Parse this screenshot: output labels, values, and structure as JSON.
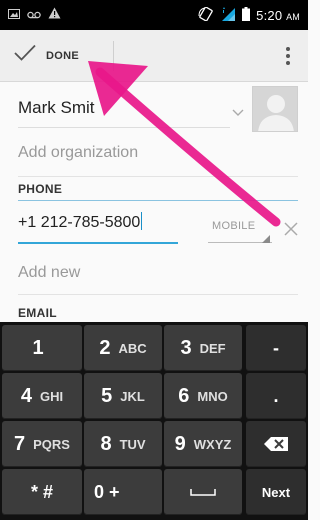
{
  "status_bar": {
    "time": "5:20",
    "ampm": "AM",
    "left_icons": [
      "image-notification-icon",
      "voicemail-icon",
      "warning-icon"
    ],
    "right_icons": [
      "rotation-icon",
      "signal-icon",
      "battery-icon"
    ]
  },
  "action_bar": {
    "done_label": "DONE",
    "overflow_icon": "overflow-menu-icon"
  },
  "form": {
    "name_value": "Mark Smit",
    "add_organization": "Add organization",
    "phone_section": "PHONE",
    "phone_value": "+1 212-785-5800",
    "phone_type": "MOBILE",
    "add_new": "Add new",
    "email_section": "EMAIL"
  },
  "keyboard": {
    "rows": [
      [
        {
          "main": "1",
          "sub": ""
        },
        {
          "main": "2",
          "sub": "ABC"
        },
        {
          "main": "3",
          "sub": "DEF"
        },
        {
          "main": "-",
          "sub": ""
        }
      ],
      [
        {
          "main": "4",
          "sub": "GHI"
        },
        {
          "main": "5",
          "sub": "JKL"
        },
        {
          "main": "6",
          "sub": "MNO"
        },
        {
          "main": ".",
          "sub": ""
        }
      ],
      [
        {
          "main": "7",
          "sub": "PQRS"
        },
        {
          "main": "8",
          "sub": "TUV"
        },
        {
          "main": "9",
          "sub": "WXYZ"
        },
        {
          "main": "",
          "sub": ""
        }
      ],
      [
        {
          "main": "* #",
          "sub": ""
        },
        {
          "main": "0 +",
          "sub": ""
        },
        {
          "main": "",
          "sub": ""
        },
        {
          "main": "Next",
          "sub": ""
        }
      ]
    ]
  },
  "colors": {
    "accent": "#33a6d8",
    "annotation_arrow": "#e8178a",
    "keyboard_bg": "#111111",
    "key_bg": "#3c3c3c"
  }
}
